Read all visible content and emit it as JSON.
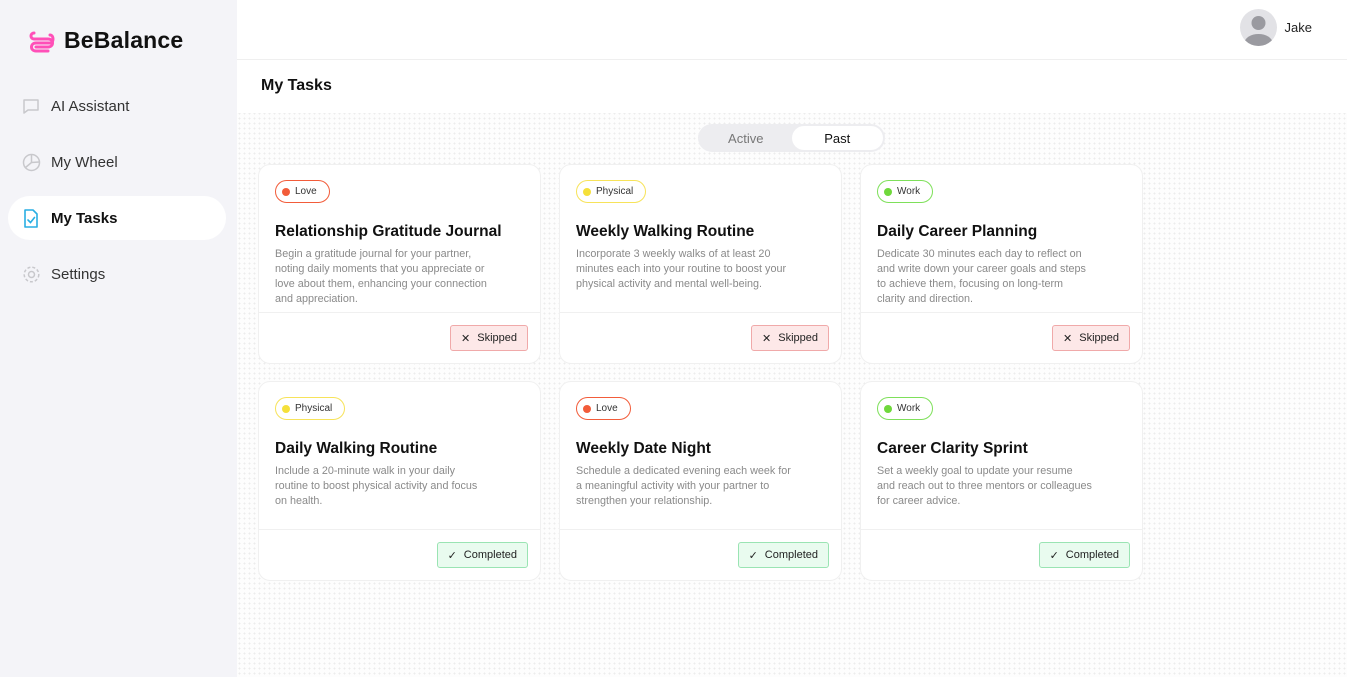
{
  "brand": {
    "name": "BeBalance",
    "logo_color": "#ff4fb8"
  },
  "nav": {
    "items": [
      {
        "label": "AI Assistant",
        "icon": "chat-icon",
        "active": false
      },
      {
        "label": "My Wheel",
        "icon": "wheel-icon",
        "active": false
      },
      {
        "label": "My Tasks",
        "icon": "tasks-icon",
        "active": true
      },
      {
        "label": "Settings",
        "icon": "gear-icon",
        "active": false
      }
    ]
  },
  "user": {
    "name": "Jake"
  },
  "page": {
    "title": "My Tasks"
  },
  "toggle": {
    "options": [
      "Active",
      "Past"
    ],
    "selected": "Past"
  },
  "colors": {
    "love": "#f25c3a",
    "physical": "#f5e03a",
    "work": "#6fd83b",
    "skipped_bg": "#fde8e8",
    "completed_bg": "#e9fbef",
    "active_icon": "#29aee3"
  },
  "tasks": [
    {
      "tag": "Love",
      "tag_type": "love",
      "title": "Relationship Gratitude Journal",
      "description": "Begin a gratitude journal for your partner, noting daily moments that you appreciate or love about them, enhancing your connection and appreciation.",
      "status": "Skipped",
      "status_icon": "x-icon"
    },
    {
      "tag": "Physical",
      "tag_type": "physical",
      "title": "Weekly Walking Routine",
      "description": "Incorporate 3 weekly walks of at least 20 minutes each into your routine to boost your physical activity and mental well-being.",
      "status": "Skipped",
      "status_icon": "x-icon"
    },
    {
      "tag": "Work",
      "tag_type": "work",
      "title": "Daily Career Planning",
      "description": "Dedicate 30 minutes each day to reflect on and write down your career goals and steps to achieve them, focusing on long-term clarity and direction.",
      "status": "Skipped",
      "status_icon": "x-icon"
    },
    {
      "tag": "Physical",
      "tag_type": "physical",
      "title": "Daily Walking Routine",
      "description": "Include a 20-minute walk in your daily routine to boost physical activity and focus on health.",
      "status": "Completed",
      "status_icon": "check-icon"
    },
    {
      "tag": "Love",
      "tag_type": "love",
      "title": "Weekly Date Night",
      "description": "Schedule a dedicated evening each week for a meaningful activity with your partner to strengthen your relationship.",
      "status": "Completed",
      "status_icon": "check-icon"
    },
    {
      "tag": "Work",
      "tag_type": "work",
      "title": "Career Clarity Sprint",
      "description": "Set a weekly goal to update your resume and reach out to three mentors or colleagues for career advice.",
      "status": "Completed",
      "status_icon": "check-icon"
    }
  ]
}
